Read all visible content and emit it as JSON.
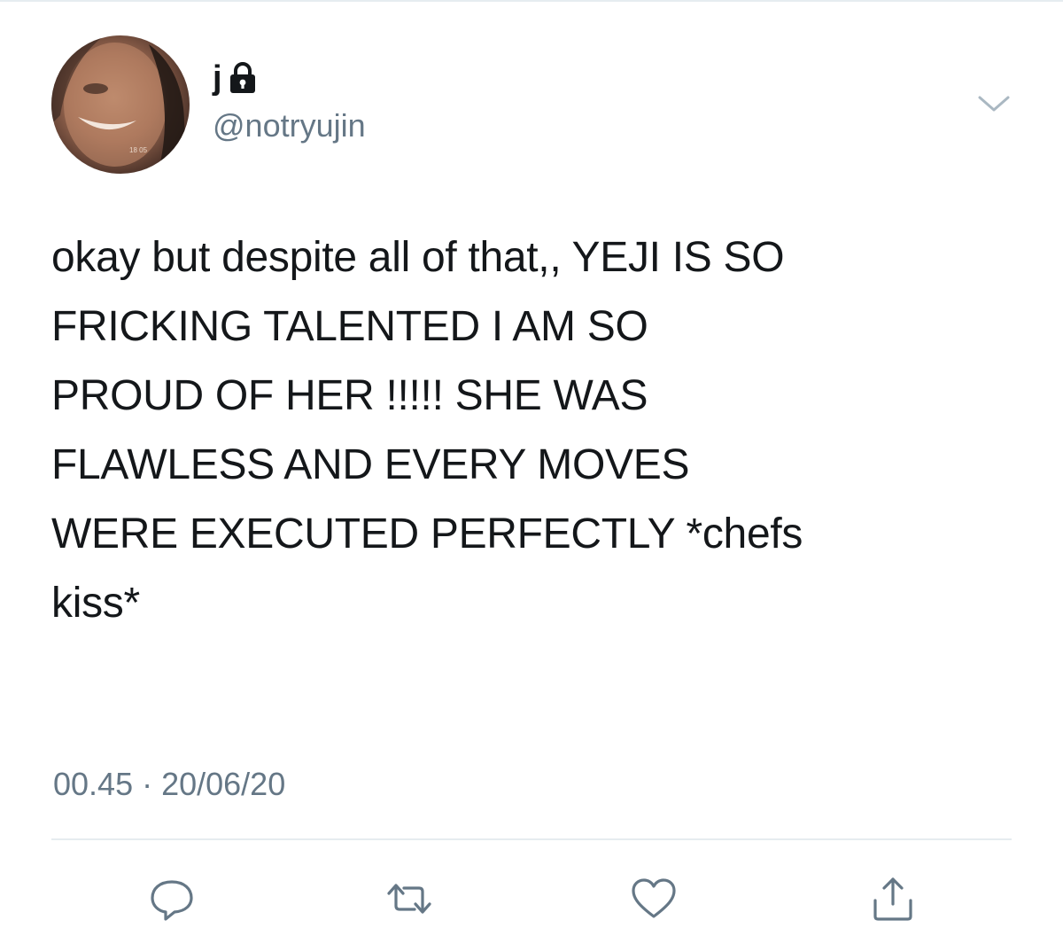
{
  "tweet": {
    "display_name": "j",
    "handle": "@notryujin",
    "text_lines": [
      "okay but despite all of that,, YEJI IS SO",
      "FRICKING TALENTED I AM SO",
      "PROUD OF HER !!!!! SHE WAS",
      "FLAWLESS AND EVERY MOVES",
      "WERE EXECUTED PERFECTLY *chefs",
      "kiss*"
    ],
    "time": "00.45",
    "separator": "·",
    "date": "20/06/20"
  },
  "icons": {
    "protected": "lock-icon",
    "more": "chevron-down-icon",
    "reply": "reply-icon",
    "retweet": "retweet-icon",
    "like": "heart-icon",
    "share": "share-icon"
  },
  "colors": {
    "text": "#14171a",
    "secondary": "#657786",
    "divider": "#e6ecf0"
  }
}
